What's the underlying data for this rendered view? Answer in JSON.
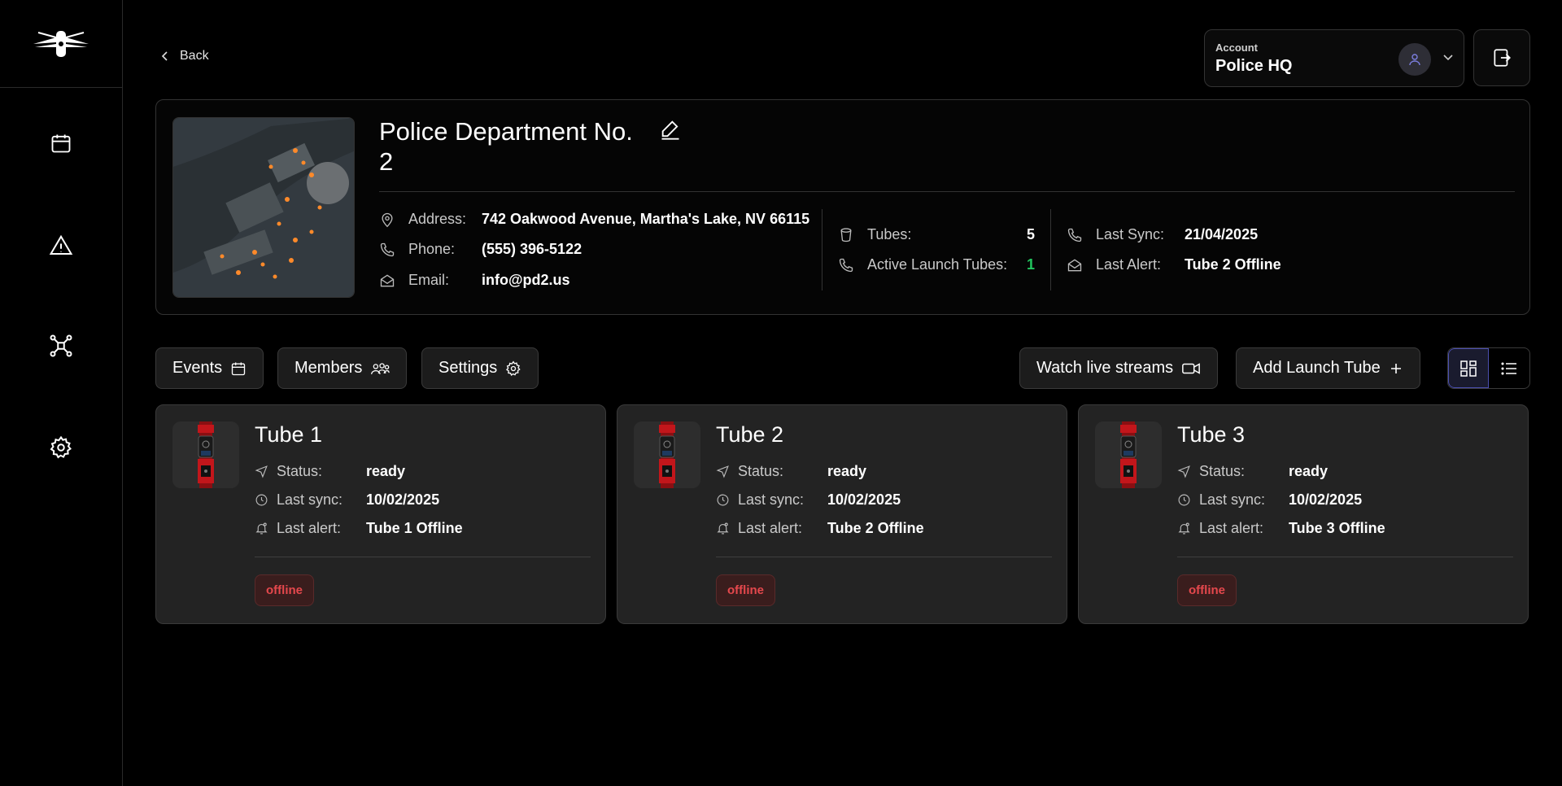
{
  "back_label": "Back",
  "account": {
    "label": "Account",
    "value": "Police HQ"
  },
  "department": {
    "name": "Police Department No. 2",
    "address_label": "Address:",
    "address": "742 Oakwood Avenue, Martha's Lake, NV 66115",
    "phone_label": "Phone:",
    "phone": "(555) 396-5122",
    "email_label": "Email:",
    "email": "info@pd2.us",
    "tubes_label": "Tubes:",
    "tubes": "5",
    "active_label": "Active Launch Tubes:",
    "active": "1",
    "last_sync_label": "Last Sync:",
    "last_sync": "21/04/2025",
    "last_alert_label": "Last Alert:",
    "last_alert": "Tube 2 Offline"
  },
  "tabs": {
    "events": "Events",
    "members": "Members",
    "settings": "Settings"
  },
  "actions": {
    "watch": "Watch live streams",
    "add": "Add Launch Tube"
  },
  "card_labels": {
    "status": "Status:",
    "last_sync": "Last sync:",
    "last_alert": "Last alert:"
  },
  "tubes": [
    {
      "name": "Tube 1",
      "status": "ready",
      "last_sync": "10/02/2025",
      "last_alert": "Tube 1 Offline",
      "badge": "offline"
    },
    {
      "name": "Tube 2",
      "status": "ready",
      "last_sync": "10/02/2025",
      "last_alert": "Tube 2 Offline",
      "badge": "offline"
    },
    {
      "name": "Tube 3",
      "status": "ready",
      "last_sync": "10/02/2025",
      "last_alert": "Tube 3 Offline",
      "badge": "offline"
    }
  ],
  "colors": {
    "accent": "#4b4fb0",
    "active_green": "#22c55e",
    "offline_red": "#e5484d",
    "card_bg": "#232323"
  }
}
